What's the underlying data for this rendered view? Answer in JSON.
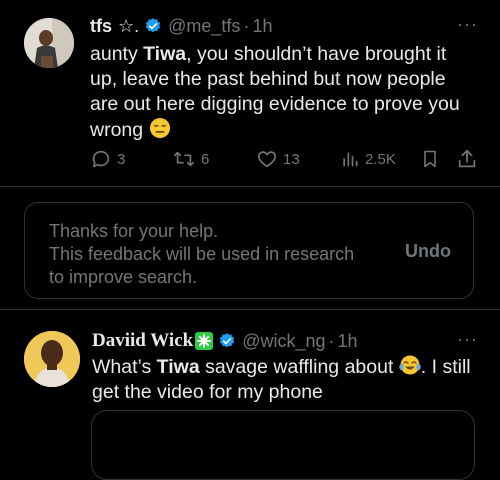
{
  "tweet1": {
    "name": "tfs",
    "name_decoration": "☆.",
    "handle": "@me_tfs",
    "separator": "·",
    "time": "1h",
    "body_pre": "aunty ",
    "body_bold": "Tiwa",
    "body_post": ", you shouldn’t have brought it up, leave the past behind but now people are out here digging evidence to prove you wrong",
    "reply_count": "3",
    "retweet_count": "6",
    "like_count": "13",
    "view_count": "2.5K",
    "more": "···"
  },
  "feedback": {
    "line1": "Thanks for your help.",
    "line2": "This feedback will be used in research",
    "line3": "to improve search.",
    "undo_label": "Undo"
  },
  "tweet2": {
    "name": "Daviid Wick",
    "handle": "@wick_ng",
    "separator": "·",
    "time": "1h",
    "body_pre": "What’s ",
    "body_bold": "Tiwa",
    "body_mid": " savage waffling about ",
    "body_post": ". I still get the video for my phone",
    "more": "···"
  },
  "colors": {
    "background": "#000000",
    "text": "#e7e9ea",
    "muted": "#71767b",
    "verified": "#1d9bf0",
    "border": "#2f3336"
  },
  "icons": [
    "reply-icon",
    "retweet-icon",
    "like-icon",
    "views-icon",
    "bookmark-icon",
    "share-icon",
    "verified-badge-icon",
    "more-icon"
  ]
}
